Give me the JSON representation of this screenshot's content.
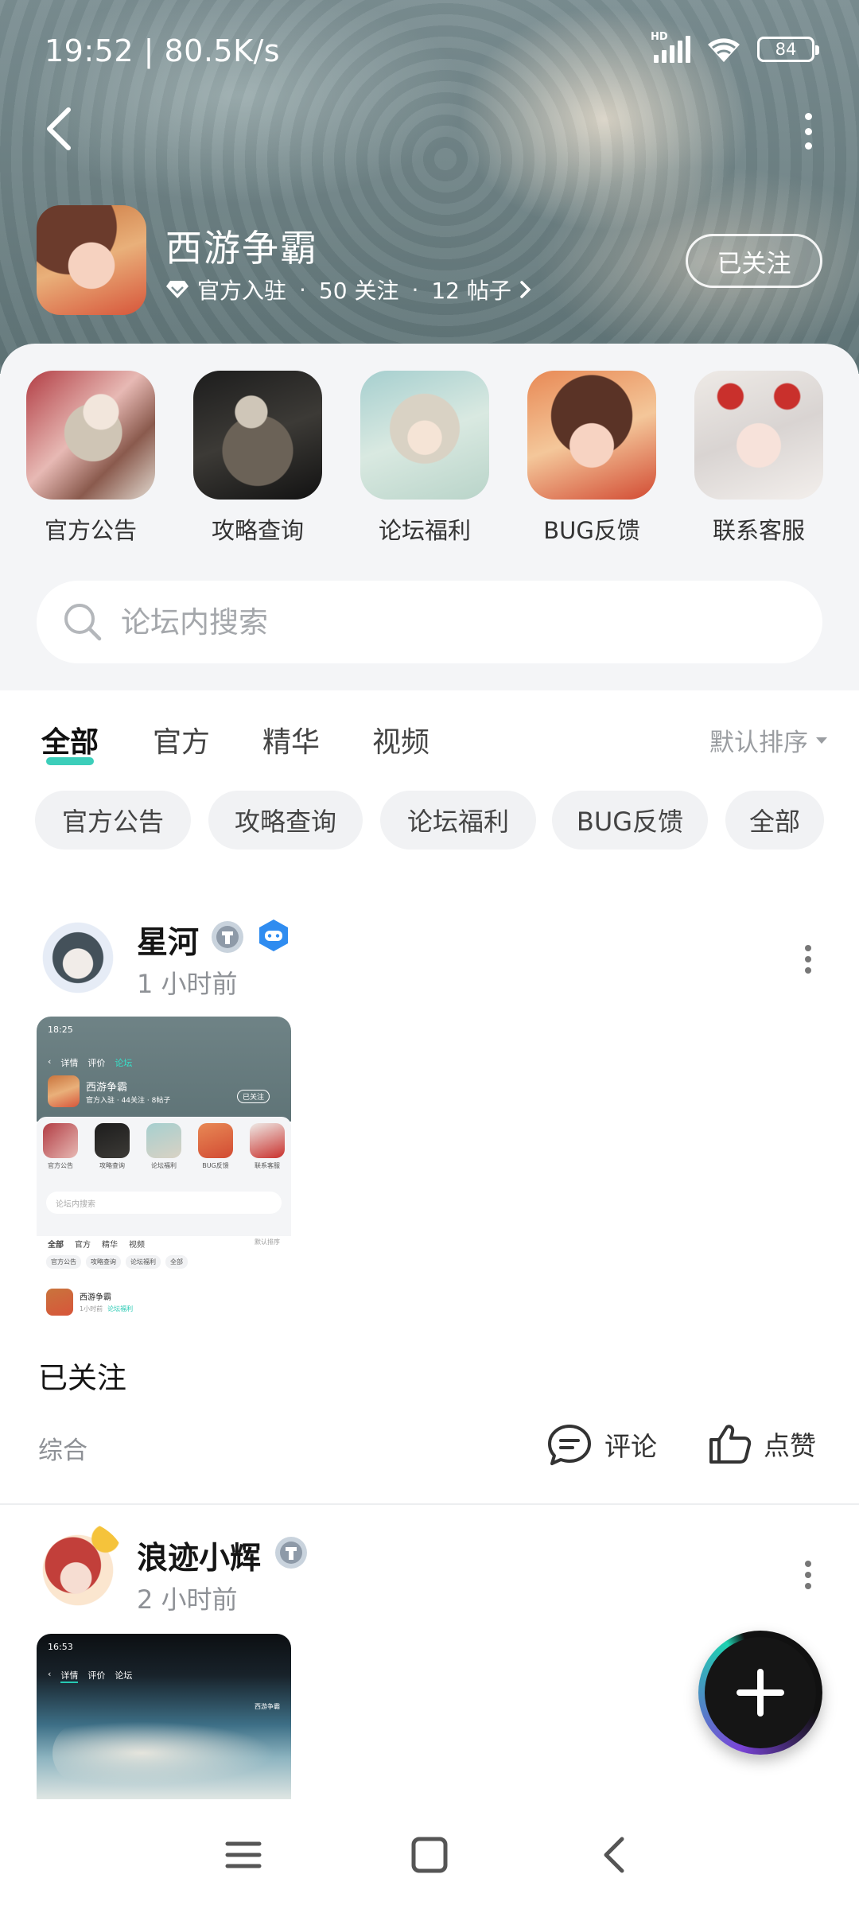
{
  "status_bar": {
    "time": "19:52 | 80.5K/s",
    "network_label": "HD",
    "battery": "84"
  },
  "header": {
    "game_name": "西游争霸",
    "official_badge": "官方入驻",
    "followers": "50 关注",
    "posts": "12 帖子",
    "follow_button": "已关注"
  },
  "quick_entries": [
    {
      "label": "官方公告"
    },
    {
      "label": "攻略查询"
    },
    {
      "label": "论坛福利"
    },
    {
      "label": "BUG反馈"
    },
    {
      "label": "联系客服"
    }
  ],
  "search": {
    "placeholder": "论坛内搜索"
  },
  "tabs": [
    {
      "label": "全部",
      "active": true
    },
    {
      "label": "官方"
    },
    {
      "label": "精华"
    },
    {
      "label": "视频"
    }
  ],
  "sort": {
    "label": "默认排序"
  },
  "chips": [
    "官方公告",
    "攻略查询",
    "论坛福利",
    "BUG反馈",
    "全部"
  ],
  "posts": [
    {
      "author": "星河",
      "time": "1 小时前",
      "text": "已关注",
      "category": "综合",
      "comment_label": "评论",
      "like_label": "点赞",
      "screenshot": {
        "time": "18:25",
        "tabs": [
          "详情",
          "评价",
          "论坛"
        ],
        "game_name": "西游争霸",
        "meta": "官方入驻 · 44关注 · 8帖子",
        "follow": "已关注",
        "entries": [
          "官方公告",
          "攻略查询",
          "论坛福利",
          "BUG反馈",
          "联系客服"
        ],
        "search": "论坛内搜索",
        "ftabs": [
          "全部",
          "官方",
          "精华",
          "视频"
        ],
        "sort": "默认排序",
        "chips": [
          "官方公告",
          "攻略查询",
          "论坛福利",
          "全部"
        ],
        "post_author": "西游争霸",
        "post_time": "1小时前",
        "post_tag": "论坛福利"
      }
    },
    {
      "author": "浪迹小辉",
      "time": "2 小时前",
      "screenshot": {
        "time": "16:53",
        "tabs": [
          "详情",
          "评价",
          "论坛"
        ],
        "corner": "西游争霸"
      }
    }
  ],
  "colors": {
    "accent": "#27c9b3",
    "fab_gradient_a": "#7a44d8",
    "fab_gradient_b": "#1fd1b0"
  },
  "icons": [
    "back-icon",
    "more-icon",
    "diamond-icon",
    "chevron-right-icon",
    "search-icon",
    "caret-down-icon",
    "comment-icon",
    "like-icon",
    "plus-icon",
    "menu-icon",
    "home-square-icon",
    "nav-back-icon"
  ]
}
